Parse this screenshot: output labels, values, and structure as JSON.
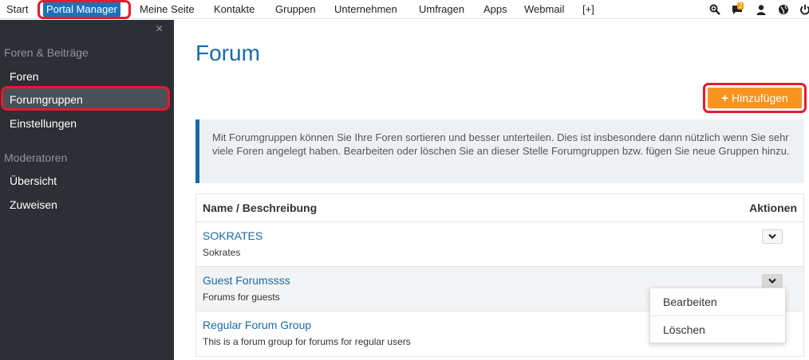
{
  "topnav": {
    "items": [
      "Start",
      "Portal Manager",
      "Meine Seite",
      "Kontakte",
      "Gruppen",
      "Unternehmen",
      "Umfragen",
      "Apps",
      "Webmail",
      "[+]"
    ],
    "active": "Portal Manager",
    "icons": [
      "search-icon",
      "chat-icon",
      "user-icon",
      "globe-icon",
      "power-icon"
    ],
    "chat_badge": "2"
  },
  "sidebar": {
    "close_label": "×",
    "section1": "Foren & Beiträge",
    "items1": [
      "Foren",
      "Forumgruppen",
      "Einstellungen"
    ],
    "active": "Forumgruppen",
    "section2": "Moderatoren",
    "items2": [
      "Übersicht",
      "Zuweisen"
    ]
  },
  "main": {
    "title": "Forum",
    "add_button": "Hinzufügen",
    "info_text": "Mit Forumgruppen können Sie Ihre Foren sortieren und besser unterteilen. Dies ist insbesondere dann nützlich wenn Sie sehr viele Foren angelegt haben. Bearbeiten oder löschen Sie an dieser Stelle Forumgruppen bzw. fügen Sie neue Gruppen hinzu.",
    "table": {
      "col_name": "Name / Beschreibung",
      "col_actions": "Aktionen",
      "rows": [
        {
          "name": "SOKRATES",
          "desc": "Sokrates"
        },
        {
          "name": "Guest Forumssss",
          "desc": "Forums for guests"
        },
        {
          "name": "Regular Forum Group",
          "desc": "This is a forum group for forums for regular users"
        }
      ]
    },
    "dropdown": {
      "items": [
        "Bearbeiten",
        "Löschen"
      ]
    }
  },
  "colors": {
    "accent": "#1a6aa8",
    "button": "#f7931e",
    "highlight": "#e8192c",
    "sidebar_bg": "#2c3036"
  }
}
